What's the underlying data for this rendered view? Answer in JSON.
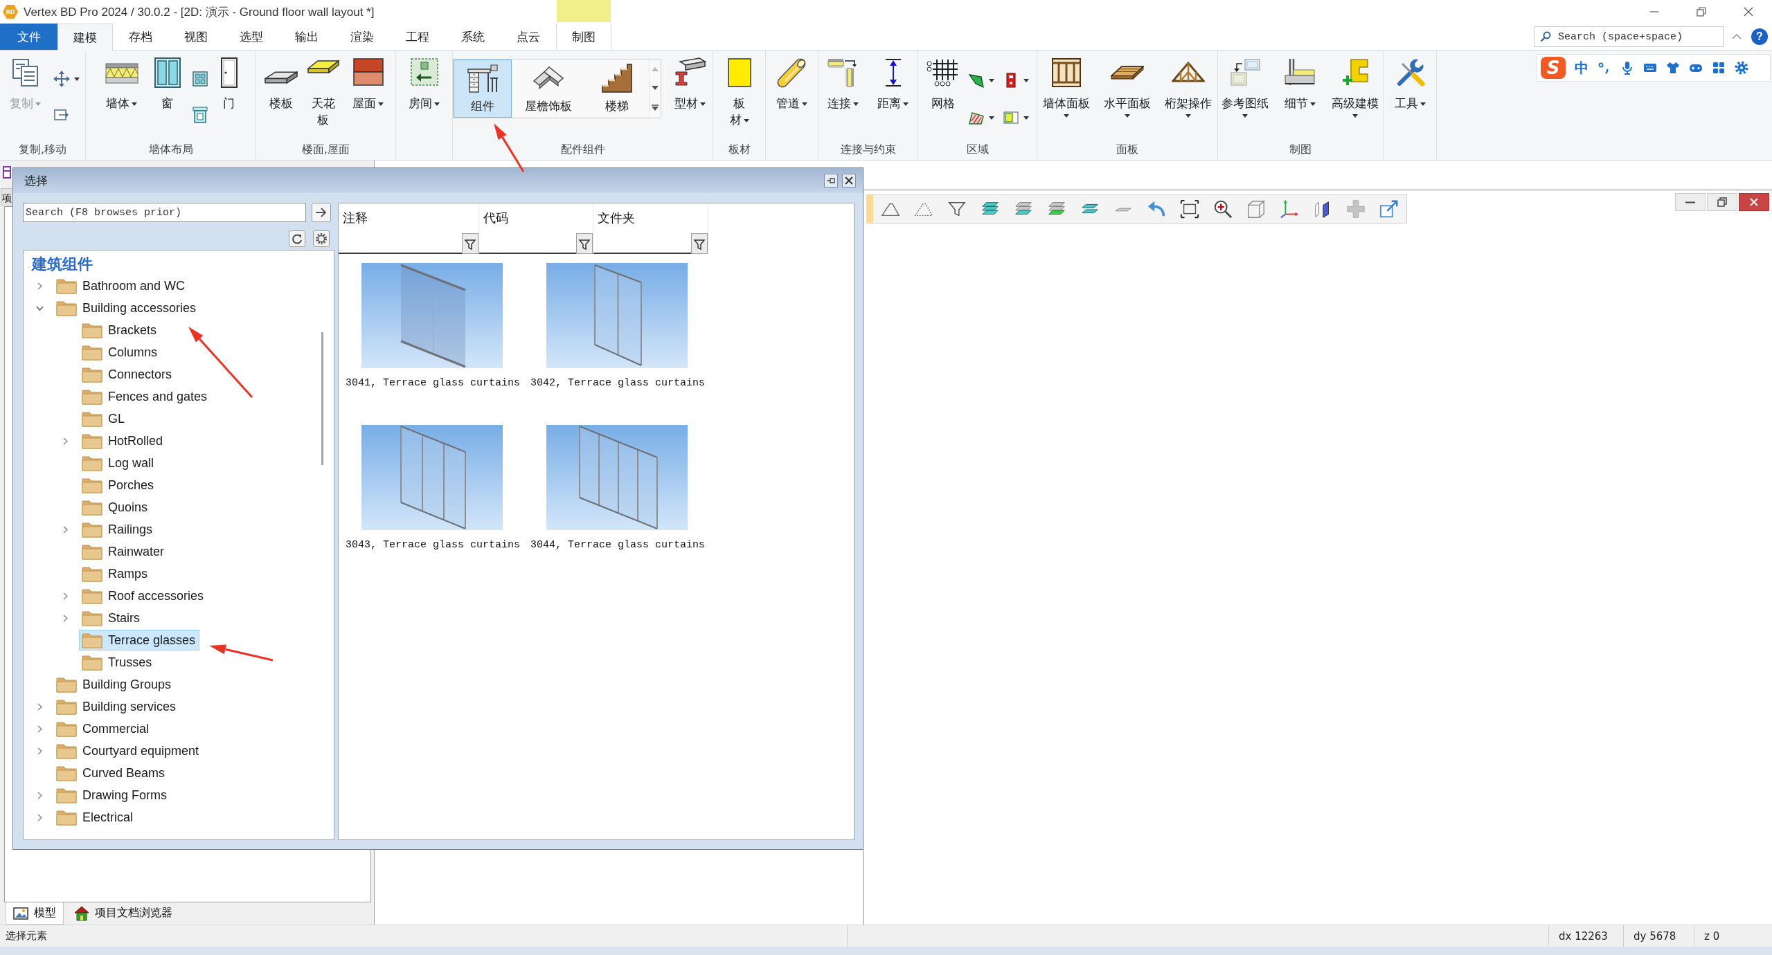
{
  "window": {
    "app_badge": "BD",
    "title": "Vertex BD Pro 2024 / 30.0.2 - [2D: 演示 - Ground floor wall layout *]"
  },
  "menu_tabs": [
    {
      "label": "文件",
      "kind": "file",
      "selected": false,
      "contextual": false
    },
    {
      "label": "建模",
      "kind": "tab",
      "selected": true,
      "contextual": false
    },
    {
      "label": "存档",
      "kind": "tab",
      "selected": false,
      "contextual": false
    },
    {
      "label": "视图",
      "kind": "tab",
      "selected": false,
      "contextual": false
    },
    {
      "label": "选型",
      "kind": "tab",
      "selected": false,
      "contextual": false
    },
    {
      "label": "输出",
      "kind": "tab",
      "selected": false,
      "contextual": false
    },
    {
      "label": "渲染",
      "kind": "tab",
      "selected": false,
      "contextual": false
    },
    {
      "label": "工程",
      "kind": "tab",
      "selected": false,
      "contextual": false
    },
    {
      "label": "系统",
      "kind": "tab",
      "selected": false,
      "contextual": false
    },
    {
      "label": "点云",
      "kind": "tab",
      "selected": false,
      "contextual": false
    },
    {
      "label": "制图",
      "kind": "tab",
      "selected": false,
      "contextual": true
    }
  ],
  "search": {
    "placeholder": "Search (space+space)"
  },
  "help_button": {
    "label": "?"
  },
  "ime_toolbar": {
    "logo": "S",
    "mode": "中"
  },
  "ribbon": {
    "groups": [
      {
        "label": "复制,移动",
        "items": [
          {
            "kind": "large",
            "label": "复制",
            "dropdown": true,
            "disabled": true
          },
          {
            "kind": "column",
            "buttons": [
              {
                "dropdown": true,
                "disabled": false
              },
              {
                "dropdown": false,
                "disabled": false
              }
            ]
          }
        ]
      },
      {
        "label": "墙体布局",
        "items": [
          {
            "kind": "large",
            "label": "墙体",
            "dropdown": true,
            "disabled": false
          },
          {
            "kind": "large",
            "label": "窗",
            "dropdown": false,
            "disabled": false
          },
          {
            "kind": "column",
            "buttons": [
              {
                "dropdown": false,
                "disabled": false
              },
              {
                "dropdown": false,
                "disabled": false
              }
            ]
          },
          {
            "kind": "large",
            "label": "门",
            "dropdown": false,
            "disabled": false
          }
        ]
      },
      {
        "label": "楼面,屋面",
        "items": [
          {
            "kind": "large",
            "label": "楼板",
            "dropdown": false,
            "disabled": false
          },
          {
            "kind": "large",
            "label": "天花板",
            "dropdown": false,
            "disabled": false
          },
          {
            "kind": "large",
            "label": "屋面",
            "dropdown": true,
            "disabled": false
          }
        ]
      },
      {
        "items": [
          {
            "kind": "large",
            "label": "房间",
            "dropdown": true,
            "disabled": false
          }
        ]
      },
      {
        "label": "配件组件",
        "items": [
          {
            "kind": "gallery",
            "entries": [
              {
                "label": "组件",
                "selected": true
              },
              {
                "label": "屋檐饰板",
                "selected": false
              },
              {
                "label": "楼梯",
                "selected": false
              }
            ]
          },
          {
            "kind": "large",
            "label": "型材",
            "dropdown": true,
            "disabled": false
          }
        ]
      },
      {
        "label": "板材",
        "items": [
          {
            "kind": "large",
            "label": "板材",
            "dropdown": true,
            "disabled": false
          }
        ]
      },
      {
        "items": [
          {
            "kind": "large",
            "label": "管道",
            "dropdown": true,
            "disabled": false
          }
        ]
      },
      {
        "label": "连接与约束",
        "items": [
          {
            "kind": "large",
            "label": "连接",
            "dropdown": true,
            "disabled": false
          },
          {
            "kind": "large",
            "label": "距离",
            "dropdown": true,
            "disabled": false
          }
        ]
      },
      {
        "label": "区域",
        "items": [
          {
            "kind": "large",
            "label": "网格",
            "dropdown": false,
            "disabled": false
          },
          {
            "kind": "grid",
            "buttons": [
              {
                "dropdown": true,
                "disabled": false
              },
              {
                "dropdown": true,
                "disabled": false
              },
              {
                "dropdown": true,
                "disabled": false
              },
              {
                "dropdown": true,
                "disabled": false
              }
            ]
          }
        ]
      },
      {
        "label": "面板",
        "items": [
          {
            "kind": "large",
            "label": "墙体面板",
            "dropdown": true,
            "disabled": false
          },
          {
            "kind": "large",
            "label": "水平面板",
            "dropdown": true,
            "disabled": false
          },
          {
            "kind": "large",
            "label": "桁架操作",
            "dropdown": true,
            "disabled": false
          }
        ]
      },
      {
        "label": "制图",
        "items": [
          {
            "kind": "large",
            "label": "参考图纸",
            "dropdown": true,
            "disabled": false
          },
          {
            "kind": "large",
            "label": "细节",
            "dropdown": true,
            "disabled": false
          },
          {
            "kind": "large",
            "label": "高级建模",
            "dropdown": true,
            "disabled": false
          }
        ]
      },
      {
        "items": [
          {
            "kind": "large",
            "label": "工具",
            "dropdown": true,
            "disabled": false
          }
        ]
      }
    ]
  },
  "project_panel": {
    "tabs": [
      {
        "label": "项"
      }
    ],
    "bottom_tabs": [
      {
        "label": "模型",
        "selected": true
      },
      {
        "label": "项目文档浏览器",
        "selected": false
      }
    ]
  },
  "dialog": {
    "title": "选择",
    "search": {
      "placeholder": "Search (F8 browses prior)"
    },
    "tree": {
      "heading": "建筑组件",
      "items": [
        {
          "label": "Bathroom and WC",
          "expanded": false,
          "selected": false
        },
        {
          "label": "Building accessories",
          "expanded": true,
          "selected": false,
          "children": [
            {
              "label": "Brackets",
              "selected": false
            },
            {
              "label": "Columns",
              "selected": false
            },
            {
              "label": "Connectors",
              "selected": false
            },
            {
              "label": "Fences and gates",
              "selected": false
            },
            {
              "label": "GL",
              "selected": false
            },
            {
              "label": "HotRolled",
              "expanded": false,
              "selected": false
            },
            {
              "label": "Log wall",
              "selected": false
            },
            {
              "label": "Porches",
              "selected": false
            },
            {
              "label": "Quoins",
              "selected": false
            },
            {
              "label": "Railings",
              "expanded": false,
              "selected": false
            },
            {
              "label": "Rainwater",
              "selected": false
            },
            {
              "label": "Ramps",
              "selected": false
            },
            {
              "label": "Roof accessories",
              "expanded": false,
              "selected": false
            },
            {
              "label": "Stairs",
              "expanded": false,
              "selected": false
            },
            {
              "label": "Terrace glasses",
              "selected": true
            },
            {
              "label": "Trusses",
              "selected": false
            }
          ]
        },
        {
          "label": "Building Groups",
          "selected": false
        },
        {
          "label": "Building services",
          "expanded": false,
          "selected": false
        },
        {
          "label": "Commercial",
          "expanded": false,
          "selected": false
        },
        {
          "label": "Courtyard equipment",
          "expanded": false,
          "selected": false
        },
        {
          "label": "Curved Beams",
          "selected": false
        },
        {
          "label": "Drawing Forms",
          "expanded": false,
          "selected": false
        },
        {
          "label": "Electrical",
          "expanded": false,
          "selected": false
        }
      ]
    },
    "columns": [
      {
        "label": "注释"
      },
      {
        "label": "代码"
      },
      {
        "label": "文件夹"
      }
    ],
    "results": [
      {
        "caption": "3041, Terrace glass curtains",
        "kind": "frameless"
      },
      {
        "caption": "3042, Terrace glass curtains",
        "kind": "double"
      },
      {
        "caption": "3043, Terrace glass curtains",
        "kind": "triple"
      },
      {
        "caption": "3044, Terrace glass curtains",
        "kind": "quad"
      }
    ]
  },
  "status_bar": {
    "message": "选择元素",
    "readouts": [
      "dx 12263",
      "dy 5678",
      "z 0"
    ]
  }
}
